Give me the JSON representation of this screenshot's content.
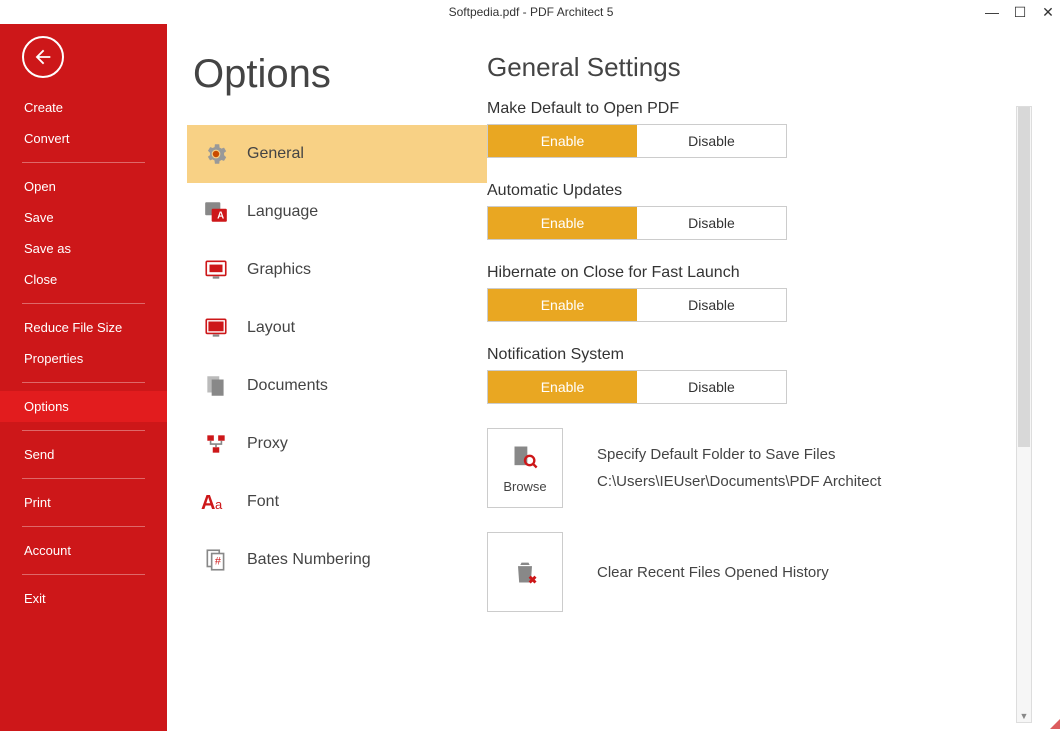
{
  "window": {
    "title_file": "Softpedia.pdf",
    "title_sep": "   -   ",
    "title_app": "PDF Architect 5"
  },
  "colors": {
    "brand_red": "#cd1719",
    "accent_orange": "#e9a722",
    "selected_tab": "#f8d185"
  },
  "sidebar": {
    "groups": [
      {
        "items": [
          {
            "label": "Create"
          },
          {
            "label": "Convert"
          }
        ]
      },
      {
        "items": [
          {
            "label": "Open"
          },
          {
            "label": "Save"
          },
          {
            "label": "Save as"
          },
          {
            "label": "Close"
          }
        ]
      },
      {
        "items": [
          {
            "label": "Reduce File Size"
          },
          {
            "label": "Properties"
          }
        ]
      },
      {
        "items": [
          {
            "label": "Options",
            "active": true
          }
        ]
      },
      {
        "items": [
          {
            "label": "Send"
          }
        ]
      },
      {
        "items": [
          {
            "label": "Print"
          }
        ]
      },
      {
        "items": [
          {
            "label": "Account"
          }
        ]
      },
      {
        "items": [
          {
            "label": "Exit"
          }
        ]
      }
    ]
  },
  "page": {
    "title": "Options"
  },
  "categories": [
    {
      "label": "General",
      "icon": "gear-icon",
      "selected": true
    },
    {
      "label": "Language",
      "icon": "language-icon"
    },
    {
      "label": "Graphics",
      "icon": "graphics-icon"
    },
    {
      "label": "Layout",
      "icon": "layout-icon"
    },
    {
      "label": "Documents",
      "icon": "documents-icon"
    },
    {
      "label": "Proxy",
      "icon": "proxy-icon"
    },
    {
      "label": "Font",
      "icon": "font-icon"
    },
    {
      "label": "Bates Numbering",
      "icon": "bates-icon"
    }
  ],
  "settings": {
    "title": "General Settings",
    "toggles": [
      {
        "label": "Make Default to Open PDF",
        "enable": "Enable",
        "disable": "Disable",
        "value": "enable"
      },
      {
        "label": "Automatic Updates",
        "enable": "Enable",
        "disable": "Disable",
        "value": "enable"
      },
      {
        "label": "Hibernate on Close for Fast Launch",
        "enable": "Enable",
        "disable": "Disable",
        "value": "enable"
      },
      {
        "label": "Notification System",
        "enable": "Enable",
        "disable": "Disable",
        "value": "enable"
      }
    ],
    "browse": {
      "button": "Browse",
      "line1": "Specify Default Folder to Save Files",
      "line2": "C:\\Users\\IEUser\\Documents\\PDF Architect"
    },
    "clear": {
      "label": "Clear Recent Files Opened History"
    }
  }
}
